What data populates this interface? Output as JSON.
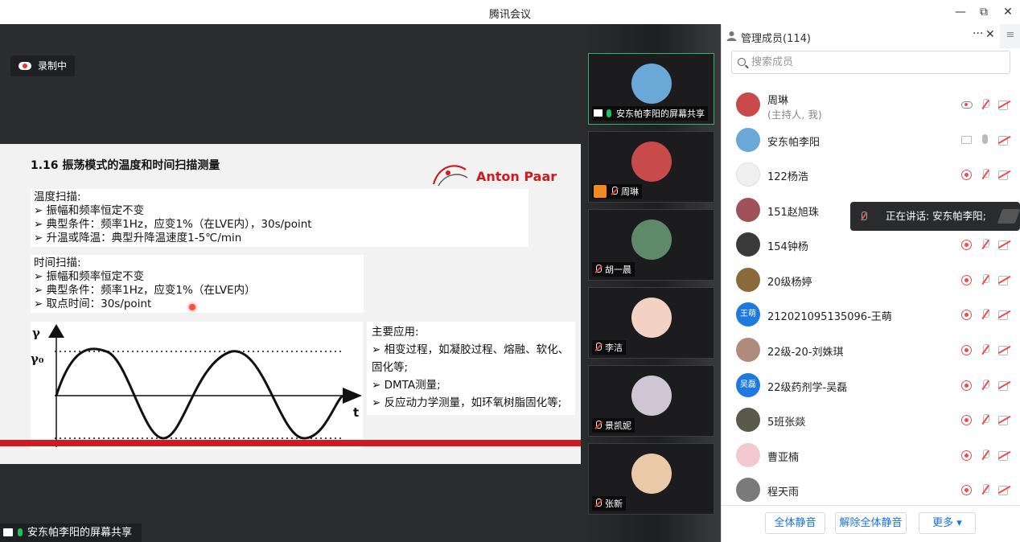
{
  "window": {
    "title": "腾讯会议",
    "minimize": "—",
    "restore": "⧉",
    "close": "✕"
  },
  "recording": {
    "label": "录制中"
  },
  "slide": {
    "title": "1.16  振荡模式的温度和时间扫描测量",
    "logo": "Anton Paar",
    "temp_scan": {
      "heading": "温度扫描:",
      "lines": [
        "➢ 振幅和频率恒定不变",
        "➢ 典型条件：频率1Hz，应变1%（在LVE内），30s/point",
        "➢ 升温或降温：典型升降温速度1-5℃/min"
      ]
    },
    "time_scan": {
      "heading": "时间扫描:",
      "lines": [
        "➢ 振幅和频率恒定不变",
        "➢ 典型条件：频率1Hz，应变1%（在LVE内）",
        "➢ 取点时间：30s/point"
      ]
    },
    "chart_labels": {
      "y_axis": "γ",
      "amplitude": "γ₀",
      "x_axis": "t"
    },
    "applications": {
      "heading": "主要应用:",
      "lines": [
        "➢ 相变过程，如凝胶过程、熔融、软化、",
        "固化等;",
        "➢ DMTA测量;",
        "➢ 反应动力学测量，如环氧树脂固化等;"
      ]
    }
  },
  "share_label": "安东帕李阳的屏幕共享",
  "gallery": [
    {
      "name": "安东帕李阳的屏幕共享",
      "color": "#6aa8d8",
      "active": true,
      "mic": "on"
    },
    {
      "name": "周琳",
      "color": "#c94a4a",
      "host": true,
      "mic": "off"
    },
    {
      "name": "胡一晨",
      "color": "#5f8a6a",
      "mic": "off"
    },
    {
      "name": "李洁",
      "color": "#f3d2c4",
      "mic": "off"
    },
    {
      "name": "景凯妮",
      "color": "#cfc6d4",
      "mic": "off"
    },
    {
      "name": "张新",
      "color": "#e9c9a8",
      "mic": "off"
    }
  ],
  "panel": {
    "title": "管理成员(114)",
    "more": "···",
    "close": "✕",
    "menu": "≡",
    "search_placeholder": "搜索成员",
    "speaking": "正在讲话: 安东帕李阳;",
    "members": [
      {
        "name": "周琳",
        "sub": "(主持人, 我)",
        "avatar_color": "#c94a4a",
        "avatar_text": "",
        "status": "host"
      },
      {
        "name": "安东帕李阳",
        "avatar_color": "#6aa8d8",
        "avatar_text": "",
        "status": "sharer"
      },
      {
        "name": "122杨浩",
        "avatar_color": "#f0f0f0",
        "avatar_text": "",
        "status": "muted"
      },
      {
        "name": "151赵旭珠",
        "avatar_color": "#a0525a",
        "avatar_text": "",
        "status": "muted"
      },
      {
        "name": "154钟杨",
        "avatar_color": "#3a3a3a",
        "avatar_text": "",
        "status": "muted"
      },
      {
        "name": "20级杨婷",
        "avatar_color": "#8a6a3a",
        "avatar_text": "",
        "status": "muted"
      },
      {
        "name": "212021095135096-王萌",
        "avatar_color": "#1f7ae0",
        "avatar_text": "王萌",
        "status": "muted"
      },
      {
        "name": "22级-20-刘姝琪",
        "avatar_color": "#b08a7a",
        "avatar_text": "",
        "status": "muted"
      },
      {
        "name": "22级药剂学-吴磊",
        "avatar_color": "#1f7ae0",
        "avatar_text": "吴磊",
        "status": "muted"
      },
      {
        "name": "5班张燚",
        "avatar_color": "#5a5a4a",
        "avatar_text": "",
        "status": "muted"
      },
      {
        "name": "曹亚楠",
        "avatar_color": "#f2c9cf",
        "avatar_text": "",
        "status": "muted"
      },
      {
        "name": "程天雨",
        "avatar_color": "#7a7a7a",
        "avatar_text": "",
        "status": "muted"
      }
    ],
    "footer": {
      "mute_all": "全体静音",
      "unmute_all": "解除全体静音",
      "more": "更多 ▾"
    }
  }
}
